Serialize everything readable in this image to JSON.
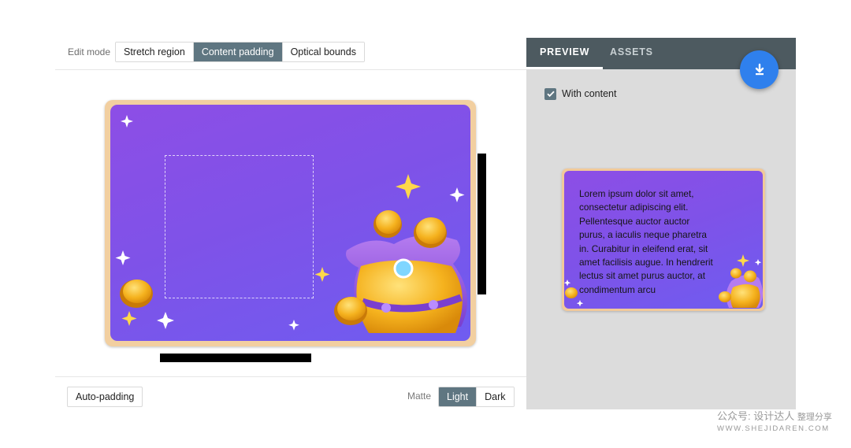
{
  "editor": {
    "edit_mode_label": "Edit mode",
    "edit_mode_options": [
      {
        "label": "Stretch region",
        "active": false
      },
      {
        "label": "Content padding",
        "active": true
      },
      {
        "label": "Optical bounds",
        "active": false
      }
    ],
    "auto_padding_label": "Auto-padding",
    "matte_label": "Matte",
    "matte_options": [
      {
        "label": "Light",
        "active": true
      },
      {
        "label": "Dark",
        "active": false
      }
    ]
  },
  "preview": {
    "tabs": [
      {
        "label": "PREVIEW",
        "active": true
      },
      {
        "label": "ASSETS",
        "active": false
      }
    ],
    "download_icon": "download-icon",
    "with_content_label": "With content",
    "with_content_checked": true,
    "sample_text": "Lorem ipsum dolor sit amet, consectetur adipiscing elit. Pellentesque auctor auctor purus, a iaculis neque pharetra in. Curabitur in eleifend erat, sit amet facilisis augue. In hendrerit lectus sit amet purus auctor, at condimentum arcu"
  },
  "watermark": {
    "line1_prefix": "公众号:",
    "line1_brand": "设计达人",
    "line1_suffix": "整理分享",
    "line2": "WWW.SHEJIDAREN.COM"
  },
  "colors": {
    "accent_dark": "#5f7681",
    "tab_bar": "#4d5a60",
    "fab": "#2f80ed",
    "art_purple": "#8054e8",
    "art_frame": "#f2cfa0"
  }
}
